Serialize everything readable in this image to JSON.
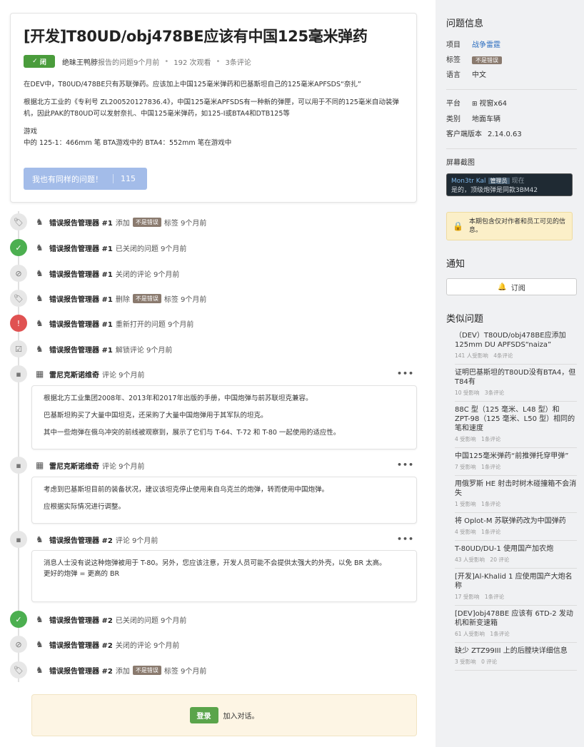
{
  "issue": {
    "title": "[开发]T80UD/obj478BE应该有中国125毫米弹药",
    "status": "闭",
    "author": "绝昧王鸭脖",
    "reported": "报告的问题9个月前",
    "views": "192 次观看",
    "comments": "3条评论",
    "body": [
      "在DEV中，T80UD/478BE只有苏联弹药。应该加上中国125毫米弹药和巴基斯坦自己的125毫米APFSDS“奈扎”",
      "根据北方工业的《专利号 ZL200520127836.4》，中国125毫米APFSDS有一种新的弹匣，可以用于不同的125毫米自动装弹机，因此PAK的T80UD可以发射奈扎、中国125毫米弹药，如125-I或BTA4和DTB125等",
      "游戏",
      "中的 125-1：466mm 笔 BTA游戏中的 BTA4：552mm 笔在游戏中"
    ],
    "same_button": "我也有同样的问题！",
    "same_count": "115"
  },
  "timeline": {
    "events": [
      {
        "who": "错误报告管理器 #1",
        "pre": "添加",
        "label": "不是错误",
        "post": "标签 9个月前",
        "icon": "tag-icon"
      },
      {
        "who": "错误报告管理器 #1",
        "pre": "已关闭的问题 9个月前",
        "icon": "check-icon"
      },
      {
        "who": "错误报告管理器 #1",
        "pre": "关闭的评论 9个月前",
        "icon": "comment-off-icon"
      },
      {
        "who": "错误报告管理器 #1",
        "pre": "删除",
        "label": "不是错误",
        "post": "标签 9个月前",
        "icon": "tag-icon"
      },
      {
        "who": "错误报告管理器 #1",
        "pre": "重新打开的问题 9个月前",
        "icon": "alert-icon"
      },
      {
        "who": "错误报告管理器 #1",
        "pre": "解锁评论 9个月前",
        "icon": "comment-check-icon"
      },
      {
        "who": "雷尼克斯诺维奇",
        "pre": "评论 9个月前",
        "icon": "comment-icon"
      },
      {
        "who": "雷尼克斯诺维奇",
        "pre": "评论 9个月前",
        "icon": "comment-icon"
      },
      {
        "who": "错误报告管理器 #2",
        "pre": "评论 9个月前",
        "icon": "comment-icon"
      },
      {
        "who": "错误报告管理器 #2",
        "pre": "已关闭的问题 9个月前",
        "icon": "check-icon"
      },
      {
        "who": "错误报告管理器 #2",
        "pre": "关闭的评论 9个月前",
        "icon": "comment-off-icon"
      },
      {
        "who": "错误报告管理器 #2",
        "pre": "添加",
        "label": "不是错误",
        "post": "标签 9个月前",
        "icon": "tag-icon"
      }
    ],
    "comment1": [
      "根据北方工业集团2008年、2013年和2017年出版的手册，中国炮弹与前苏联坦克兼容。",
      "巴基斯坦购买了大量中国坦克，还采购了大量中国炮弹用于其军队的坦克。",
      "其中一些炮弹在俄乌冲突的前线被观察到，展示了它们与 T-64、T-72 和 T-80 一起使用的适应性。"
    ],
    "comment2": [
      "考虑到巴基斯坦目前的装备状况，建议该坦克停止使用来自乌克兰的炮弹，转而使用中国炮弹。",
      "应根据实际情况进行调整。"
    ],
    "comment3": [
      "消息人士没有说这种炮弹被用于 T-80。另外，您应该注意，开发人员可能不会提供太强大的外壳，以免 BR 太高。",
      "更好的炮弹 = 更高的 BR"
    ],
    "more": "•••"
  },
  "login": {
    "button": "登录",
    "text": "加入对话。"
  },
  "sidebar": {
    "info_title": "问题信息",
    "project_k": "项目",
    "project_v": "战争雷霆",
    "tag_k": "标签",
    "tag_v": "不是错误",
    "lang_k": "语言",
    "lang_v": "中文",
    "platform_k": "平台",
    "platform_v": "视窗x64",
    "category_k": "类别",
    "category_v": "地面车辆",
    "client_k": "客户端版本",
    "client_v": "2.14.0.63",
    "screens_title": "屏幕截图",
    "shot_name": "Mon3tr Kal",
    "shot_role": "管理员",
    "shot_now": "现在",
    "shot_text": "是的，顶级炮弹是同款3BM42",
    "notice": "本期包含仅对作者和员工可见的信息。",
    "notify_title": "通知",
    "subscribe": "订阅",
    "similar_title": "类似问题",
    "similar": [
      {
        "t": "（DEV）T80UD/obj478BE应添加125mm DU APFSDS“naiza”",
        "s": "141 人受影响　4条评论"
      },
      {
        "t": "证明巴基斯坦的T80UD没有BTA4，但T84有",
        "s": "10 受影响　3条评论"
      },
      {
        "t": "88C 型（125 毫米、L48 型）和 ZPT-98（125 毫米、L50 型）相同的笔和速度",
        "s": "4 受影响　1条评论"
      },
      {
        "t": "中国125毫米弹药“前推弹托穿甲弹”",
        "s": "7 受影响　1条评论"
      },
      {
        "t": "用俄罗斯 HE 射击时树木碰撞箱不会消失",
        "s": "1 受影响　1条评论"
      },
      {
        "t": "将 Oplot-M 苏联弹药改为中国弹药",
        "s": "4 受影响　1条评论"
      },
      {
        "t": "T-80UD/DU-1 使用国产加农炮",
        "s": "43 人受影响　20 评论"
      },
      {
        "t": "[开发]Al-Khalid 1 应使用国产大炮名称",
        "s": "17 受影响　1条评论"
      },
      {
        "t": "[DEV]obj478BE 应该有 6TD-2 发动机和新变速箱",
        "s": "61 人受影响　1条评论"
      },
      {
        "t": "缺少 ZTZ99III 上的后膛块详细信息",
        "s": "3 受影响　0 评论"
      }
    ]
  }
}
